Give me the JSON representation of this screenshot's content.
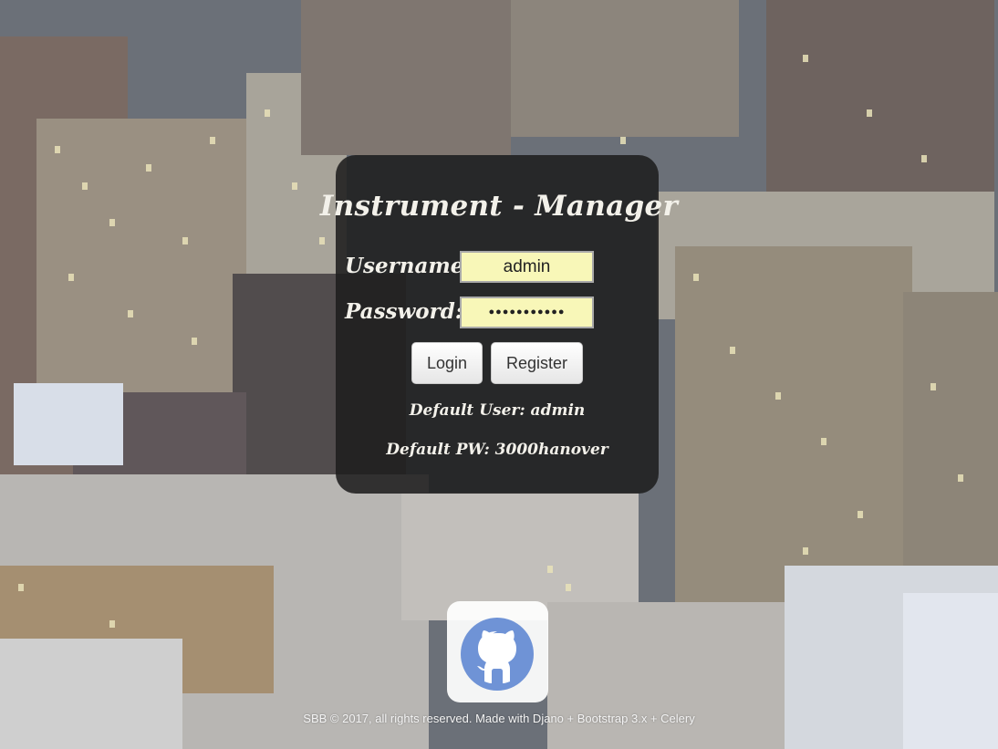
{
  "app": {
    "title": "Instrument - Manager"
  },
  "login_form": {
    "username_label": "Username:",
    "username_value": "admin",
    "password_label": "Password:",
    "password_value": "●●●●●●●●●●●",
    "login_label": "Login",
    "register_label": "Register"
  },
  "hints": {
    "default_user": "Default User: admin",
    "default_pw": "Default PW: 3000hanover"
  },
  "footer": {
    "text": "SBB © 2017, all rights reserved. Made with Djano + Bootstrap 3.x + Celery"
  },
  "icons": {
    "github": "github-icon"
  },
  "colors": {
    "panel_bg": "#1e1e1e",
    "input_bg": "#f8f7b8",
    "github_blue": "#6f93d6"
  }
}
